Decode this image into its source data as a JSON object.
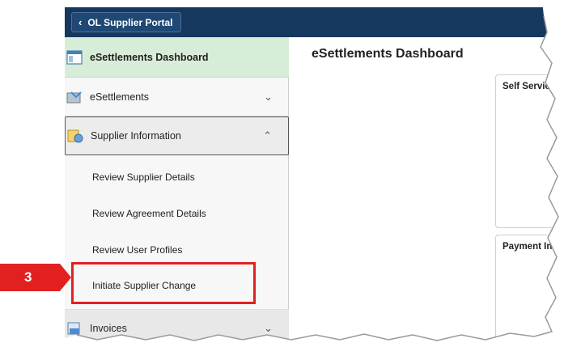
{
  "header": {
    "back_label": "OL Supplier Portal"
  },
  "sidebar": {
    "dashboard_label": "eSettlements Dashboard",
    "esettlements_label": "eSettlements",
    "supplier_info_label": "Supplier Information",
    "sub_items": [
      "Review Supplier Details",
      "Review Agreement Details",
      "Review User Profiles",
      "Initiate Supplier Change"
    ],
    "invoices_label": "Invoices"
  },
  "callout": {
    "step": "3"
  },
  "main": {
    "title": "eSettlements Dashboard",
    "tiles": [
      "Self Servic",
      "Payment In"
    ]
  },
  "colors": {
    "header_bg": "#16385f",
    "active_item_bg": "#d8edd7",
    "highlight_red": "#e32020"
  }
}
